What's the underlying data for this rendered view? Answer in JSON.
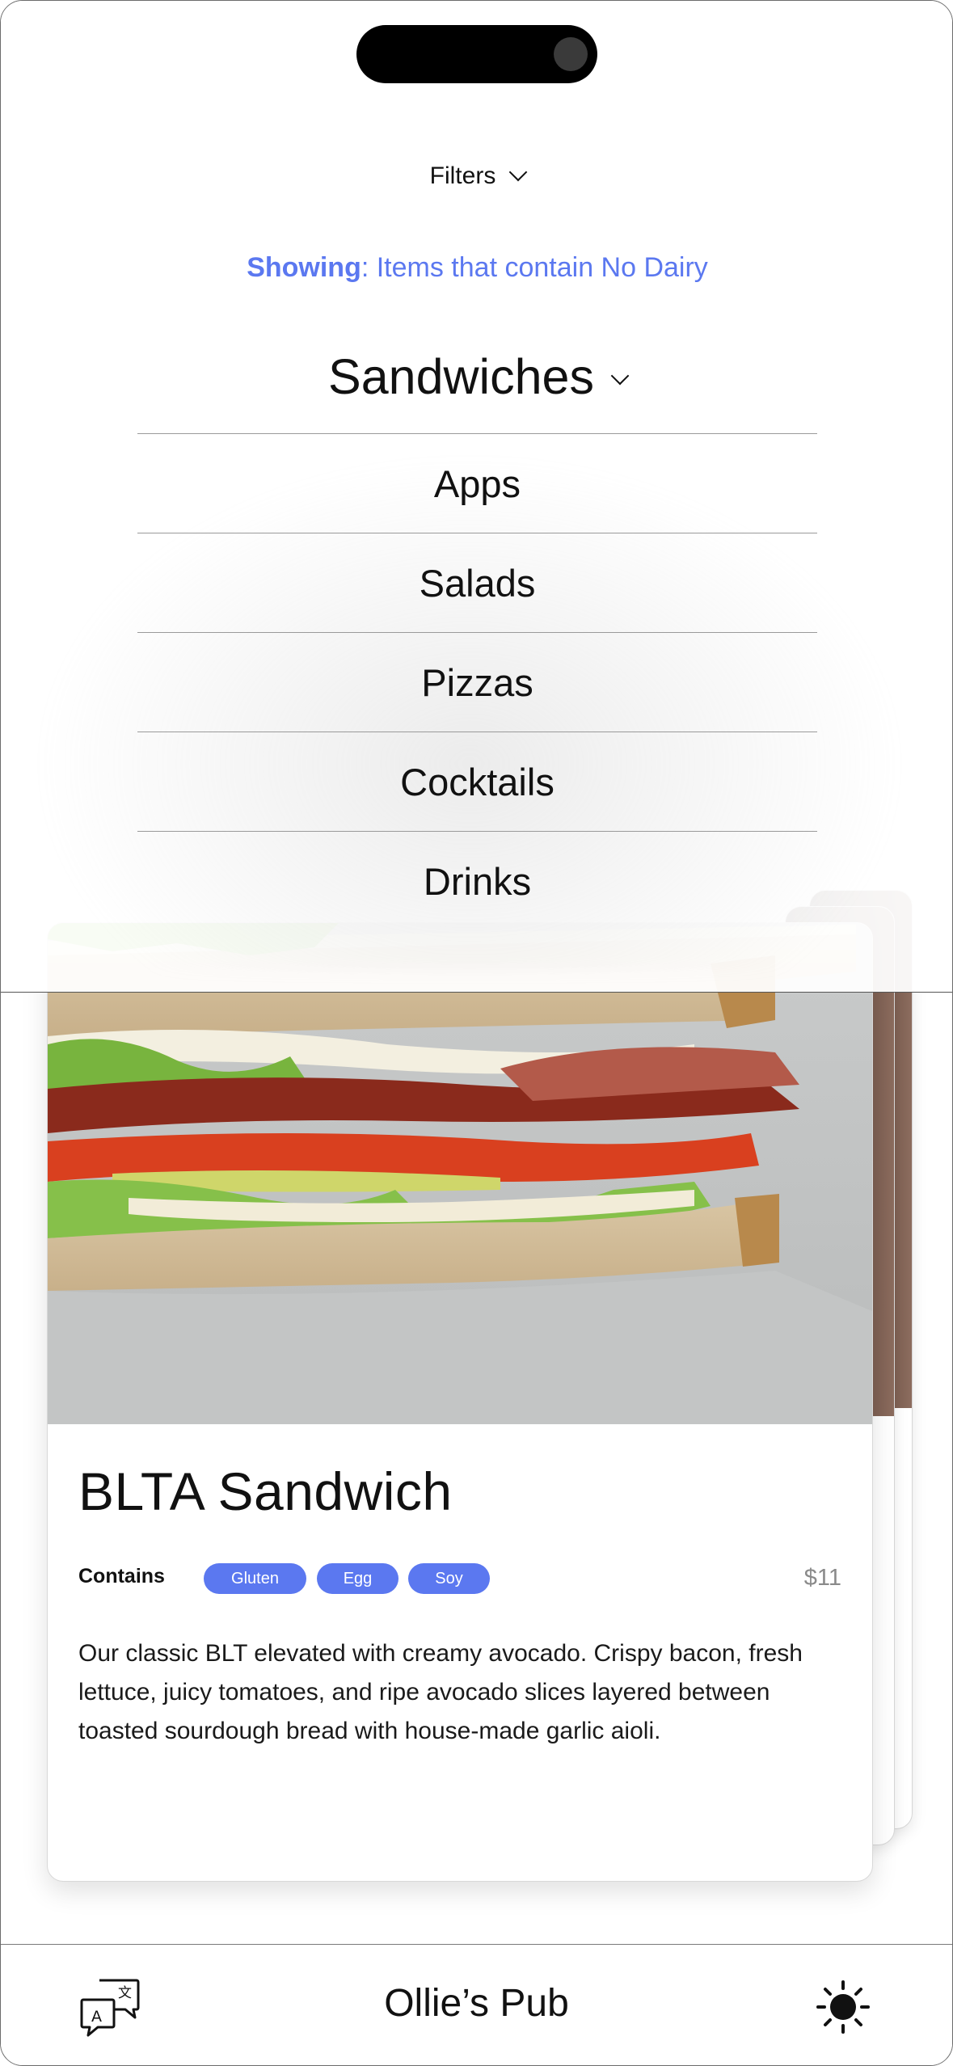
{
  "header": {
    "filters_label": "Filters",
    "showing_prefix": "Showing",
    "showing_text": ": Items that contain No Dairy",
    "current_category": "Sandwiches"
  },
  "category_menu": {
    "items": [
      {
        "label": "Apps"
      },
      {
        "label": "Salads"
      },
      {
        "label": "Pizzas"
      },
      {
        "label": "Cocktails"
      },
      {
        "label": "Drinks"
      }
    ]
  },
  "menu_card": {
    "title": "BLTA Sandwich",
    "contains_label": "Contains",
    "allergens": [
      "Gluten",
      "Egg",
      "Soy"
    ],
    "price": "$11",
    "description": "Our classic BLT elevated with creamy avocado. Crispy bacon, fresh lettuce, juicy tomatoes, and ripe avocado slices layered between toasted sourdough bread with house-made garlic aioli."
  },
  "bottom_bar": {
    "brand": "Ollie’s Pub",
    "left_icon": "translate-icon",
    "right_icon": "theme-toggle-icon"
  },
  "colors": {
    "accent": "#5b78f0",
    "text": "#111111",
    "price": "#8a8a8a"
  }
}
